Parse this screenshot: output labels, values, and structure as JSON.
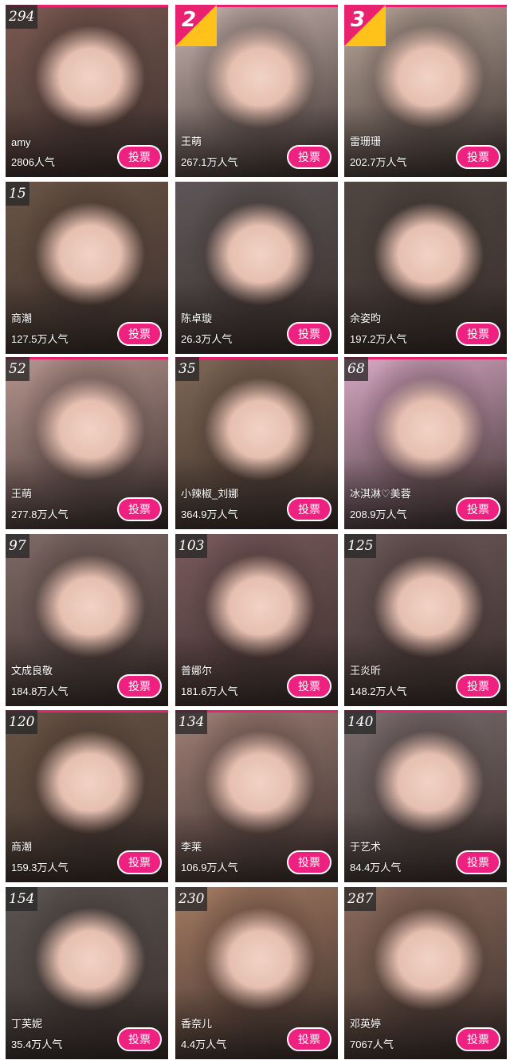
{
  "accent_color": "#ee2080",
  "vote_label": "投票",
  "cards": [
    {
      "rank": "294",
      "name": "amy",
      "popularity": "2806人气",
      "tone": "#7b5a52"
    },
    {
      "rank": "2",
      "name": "王萌",
      "popularity": "267.1万人气",
      "tone": "#c9b6b0"
    },
    {
      "rank": "3",
      "name": "雷珊珊",
      "popularity": "202.7万人气",
      "tone": "#b9a89c"
    },
    {
      "rank": "15",
      "name": "商潮",
      "popularity": "127.5万人气",
      "tone": "#6a5546"
    },
    {
      "rank": "",
      "name": "陈卓璇",
      "popularity": "26.3万人气",
      "tone": "#5d5658"
    },
    {
      "rank": "",
      "name": "余姿昀",
      "popularity": "197.2万人气",
      "tone": "#4f4641"
    },
    {
      "rank": "52",
      "name": "王萌",
      "popularity": "277.8万人气",
      "tone": "#b6958f"
    },
    {
      "rank": "35",
      "name": "小辣椒_刘娜",
      "popularity": "364.9万人气",
      "tone": "#7e6754"
    },
    {
      "rank": "68",
      "name": "冰淇淋♡美蓉",
      "popularity": "208.9万人气",
      "tone": "#d8a9c6"
    },
    {
      "rank": "97",
      "name": "文成良敬",
      "popularity": "184.8万人气",
      "tone": "#7e6a66"
    },
    {
      "rank": "103",
      "name": "普娜尔",
      "popularity": "181.6万人气",
      "tone": "#7a5a5c"
    },
    {
      "rank": "125",
      "name": "王炎昕",
      "popularity": "148.2万人气",
      "tone": "#6b5858"
    },
    {
      "rank": "120",
      "name": "商潮",
      "popularity": "159.3万人气",
      "tone": "#6a5546"
    },
    {
      "rank": "134",
      "name": "李莱",
      "popularity": "106.9万人气",
      "tone": "#9f7f76"
    },
    {
      "rank": "140",
      "name": "于艺术",
      "popularity": "84.4万人气",
      "tone": "#7c6e70"
    },
    {
      "rank": "154",
      "name": "丁芙妮",
      "popularity": "35.4万人气",
      "tone": "#5a5452"
    },
    {
      "rank": "230",
      "name": "香奈儿",
      "popularity": "4.4万人气",
      "tone": "#a47a62"
    },
    {
      "rank": "287",
      "name": "邓英婷",
      "popularity": "7067人气",
      "tone": "#8c6b5c"
    }
  ]
}
